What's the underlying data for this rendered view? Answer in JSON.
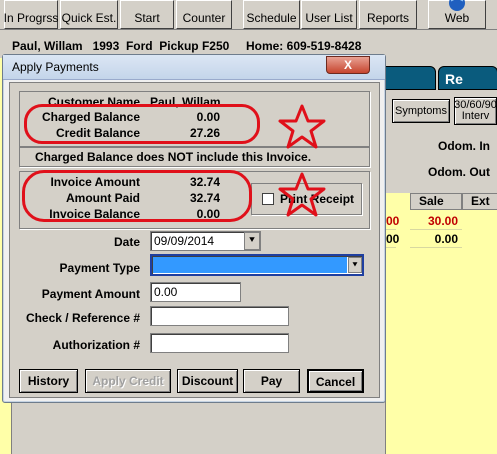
{
  "toolbar": {
    "buttons": [
      {
        "label": "In Progrss",
        "icon": "progress-icon"
      },
      {
        "label": "Quick Est.",
        "icon": "estimate-icon"
      },
      {
        "label": "Start",
        "icon": "start-icon"
      },
      {
        "label": "Counter",
        "icon": "counter-icon"
      },
      {
        "label": "Schedule",
        "icon": "schedule-icon"
      },
      {
        "label": "User List",
        "icon": "user-list-icon"
      },
      {
        "label": "Reports",
        "icon": "reports-icon"
      },
      {
        "label": "Web",
        "icon": "globe-icon"
      }
    ]
  },
  "background": {
    "customer_line": "Paul, Willam   1993  Ford  Pickup F250     Home: 609-519-8428",
    "tab_right_label": "Re",
    "symptoms_button": "Symptoms",
    "interval_button_line1": "30/60/90",
    "interval_button_line2": "Interv",
    "odom_in_label": "Odom. In",
    "odom_out_label": "Odom. Out",
    "grid_headers": [
      "Sale",
      "Ext"
    ],
    "grid_rows": [
      {
        "left": "00",
        "sale": "30.00",
        "color": "#c00000"
      },
      {
        "left": "00",
        "sale": "0.00",
        "color": "#000000"
      }
    ]
  },
  "dialog": {
    "title": "Apply Payments",
    "close_symbol": "X",
    "customer_name_label": "Customer Name",
    "customer_name_value": "Paul, Willam",
    "charged_balance_label": "Charged Balance",
    "charged_balance_value": "0.00",
    "credit_balance_label": "Credit Balance",
    "credit_balance_value": "27.26",
    "notice": "Charged Balance does NOT include this Invoice.",
    "invoice_amount_label": "Invoice Amount",
    "invoice_amount_value": "32.74",
    "amount_paid_label": "Amount Paid",
    "amount_paid_value": "32.74",
    "invoice_balance_label": "Invoice Balance",
    "invoice_balance_value": "0.00",
    "print_receipt_label": "Print Receipt",
    "print_receipt_checked": false,
    "date_label": "Date",
    "date_value": "09/09/2014",
    "payment_type_label": "Payment Type",
    "payment_type_value": "",
    "payment_amount_label": "Payment Amount",
    "payment_amount_value": "0.00",
    "check_ref_label": "Check / Reference #",
    "check_ref_value": "",
    "authorization_label": "Authorization #",
    "authorization_value": "",
    "buttons": {
      "history": "History",
      "apply_credit": "Apply Credit",
      "discount": "Discount",
      "pay": "Pay",
      "cancel": "Cancel"
    }
  },
  "annotation_colors": {
    "highlight": "#e0101a"
  }
}
